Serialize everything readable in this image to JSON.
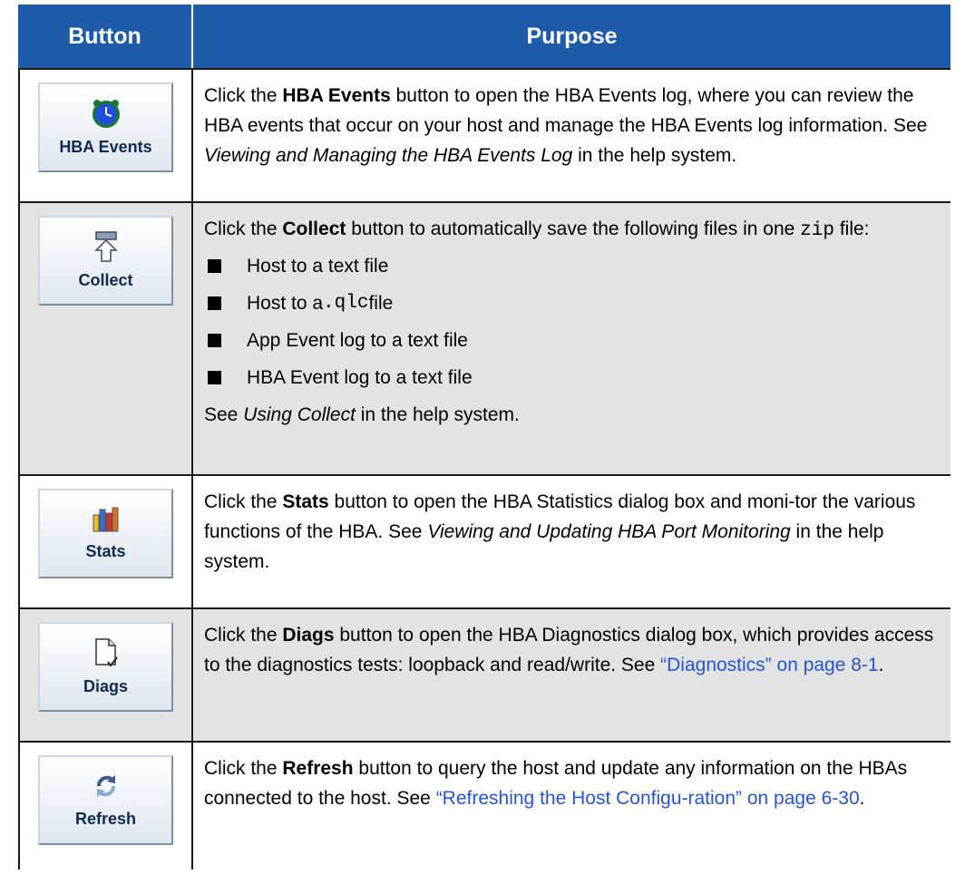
{
  "table": {
    "headers": {
      "button": "Button",
      "purpose": "Purpose"
    },
    "rows": [
      {
        "button_label": "HBA Events",
        "icon": "clock-icon",
        "p1": "Click the ",
        "bold": "HBA Events",
        "p2": " button to open the HBA Events log, where you can review the HBA events that occur on your host and manage the HBA Events log information. See ",
        "italic": "Viewing and Managing the HBA Events Log",
        "p3": " in the help system."
      },
      {
        "button_label": "Collect",
        "icon": "arrow-up-icon",
        "p1": "Click the ",
        "bold": "Collect",
        "p2": " button to automatically save the following files in one ",
        "code": "zip",
        "p3": " file:",
        "bullets": [
          {
            "pre": "Host to a text file",
            "code": "",
            "post": ""
          },
          {
            "pre": "Host to a ",
            "code": ".qlc",
            "post": " file"
          },
          {
            "pre": "App Event log to a text file",
            "code": "",
            "post": ""
          },
          {
            "pre": "HBA Event log to a text file",
            "code": "",
            "post": ""
          }
        ],
        "footer_pre": "See ",
        "footer_italic": "Using Collect",
        "footer_post": " in the help system."
      },
      {
        "button_label": "Stats",
        "icon": "bar-chart-icon",
        "p1": "Click the ",
        "bold": "Stats",
        "p2": " button to open the HBA Statistics dialog box and moni-tor the various functions of the HBA. See ",
        "italic": "Viewing and Updating HBA Port Monitoring",
        "p3": " in the help system."
      },
      {
        "button_label": "Diags",
        "icon": "document-check-icon",
        "p1": "Click the ",
        "bold": "Diags",
        "p2": " button to open the HBA Diagnostics dialog box, which provides access to the diagnostics tests: loopback and read/write. See ",
        "link": "“Diagnostics” on page 8-1",
        "p3": "."
      },
      {
        "button_label": "Refresh",
        "icon": "refresh-icon",
        "p1": "Click the ",
        "bold": "Refresh",
        "p2": " button to query the host and update any information on the HBAs connected to the host. See ",
        "link": "“Refreshing the Host Configu-ration” on page 6-30",
        "p3": "."
      }
    ]
  },
  "colors": {
    "header_bg": "#1e5ba8",
    "row_shade": "#e3e3e3",
    "link": "#2356d6"
  }
}
